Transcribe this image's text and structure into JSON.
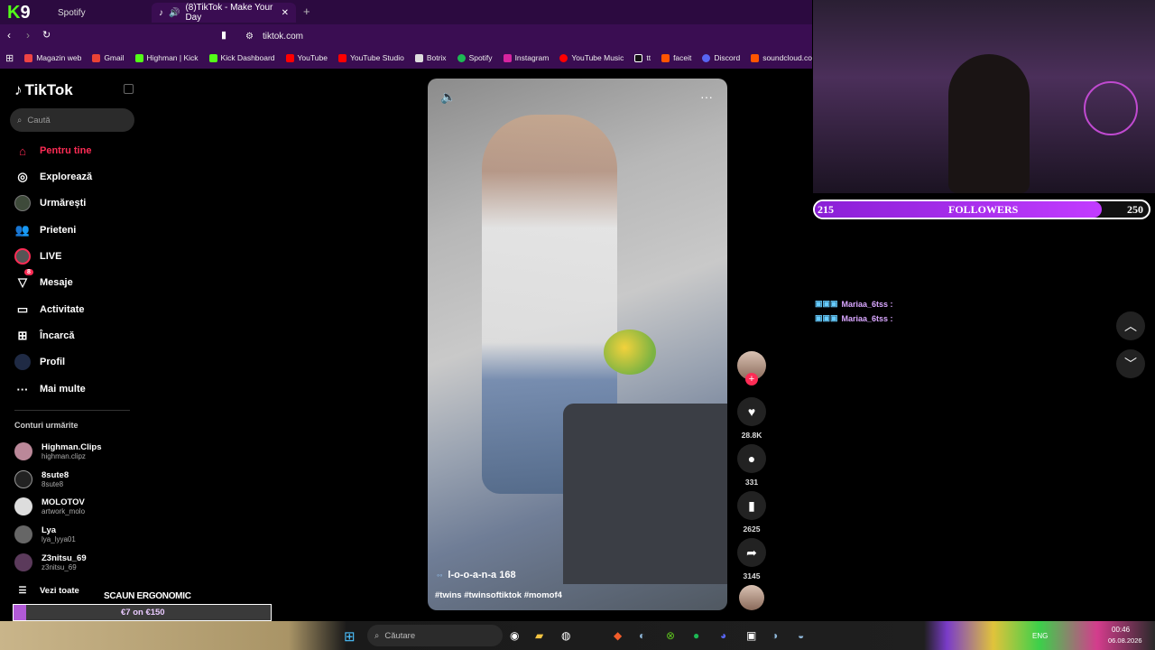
{
  "browser": {
    "tabs": [
      {
        "label": "Spotify"
      },
      {
        "label": "(8)TikTok - Make Your Day"
      }
    ],
    "url": "tiktok.com",
    "bookmarks": [
      "Magazin web",
      "Gmail",
      "Highman | Kick",
      "Kick Dashboard",
      "YouTube",
      "YouTube Studio",
      "Botrix",
      "Spotify",
      "Instagram",
      "YouTube Music",
      "tt",
      "faceit",
      "Discord",
      "soundcloud.com/"
    ]
  },
  "sidebar": {
    "logo": "TikTok",
    "search_placeholder": "Caută",
    "nav": [
      {
        "label": "Pentru tine",
        "active": true
      },
      {
        "label": "Explorează"
      },
      {
        "label": "Urmărești"
      },
      {
        "label": "Prieteni"
      },
      {
        "label": "LIVE"
      },
      {
        "label": "Mesaje",
        "badge": "8"
      },
      {
        "label": "Activitate"
      },
      {
        "label": "Încarcă"
      },
      {
        "label": "Profil"
      },
      {
        "label": "Mai multe"
      }
    ],
    "following_title": "Conturi urmărite",
    "accounts": [
      {
        "name": "Highman.Clips",
        "handle": "highman.clipz"
      },
      {
        "name": "8sute8",
        "handle": "8sute8"
      },
      {
        "name": "MOLOTOV",
        "handle": "artwork_molo"
      },
      {
        "name": "Lya",
        "handle": "lya_lyya01"
      },
      {
        "name": "Z3nitsu_69",
        "handle": "z3nitsu_69"
      }
    ],
    "see_all": "Vezi toate"
  },
  "video": {
    "author": "l-o-o-a-n-a 168",
    "hashtags": "#twins #twinsoftiktok #momof4",
    "likes": "28.8K",
    "comments": "331",
    "saves": "2625",
    "shares": "3145"
  },
  "stream": {
    "followers_current": "215",
    "followers_label": "FOLLOWERS",
    "followers_goal": "250",
    "followers_progress": 0.86,
    "chat": [
      {
        "user": "Mariaa_6tss :"
      },
      {
        "user": "Mariaa_6tss :"
      }
    ],
    "promo_title": "SCAUN ERGONOMIC",
    "promo_text": "€7 on €150"
  },
  "taskbar": {
    "search_placeholder": "Căutare",
    "lang": "ENG",
    "time": "00:46",
    "date": "06.08.2026"
  },
  "colors": {
    "accent": "#fe2c55",
    "chrome": "#3a0d52",
    "followers_bar": "#a62ef0"
  }
}
